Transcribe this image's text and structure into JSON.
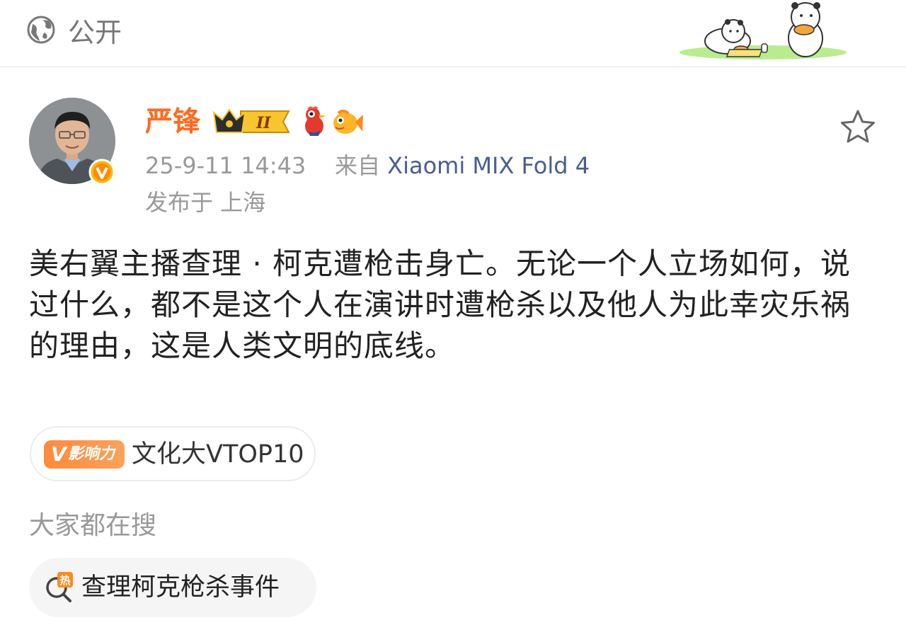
{
  "topbar": {
    "visibility_icon": "globe-icon",
    "visibility_label": "公开",
    "banner_art": "bears-picnic-illustration"
  },
  "post": {
    "username": "严锋",
    "badges": [
      "crown-level-II-badge",
      "rooster-badge",
      "fish-badge"
    ],
    "crown_level": "II",
    "verified_icon": "verified-v-badge",
    "timestamp": "25-9-11 14:43",
    "source_prefix": "来自",
    "device": "Xiaomi MIX Fold 4",
    "location": "发布于 上海",
    "text": "美右翼主播查理 · 柯克遭枪击身亡。无论一个人立场如何，说过什么，都不是这个人在演讲时遭枪杀以及他人为此幸灾乐祸的理由，这是人类文明的底线。",
    "favorite_icon": "star-icon"
  },
  "influence_tag": {
    "badge_v": "V",
    "badge_text": "影响力",
    "label": "文化大VTOP10"
  },
  "search": {
    "heading": "大家都在搜",
    "hot_icon_text": "热",
    "hot_label": "查理柯克枪杀事件"
  },
  "colors": {
    "username": "#ff6a1f",
    "device": "#4a5d8f",
    "meta_gray": "#999999",
    "tag_orange": "#ff8a3d"
  }
}
